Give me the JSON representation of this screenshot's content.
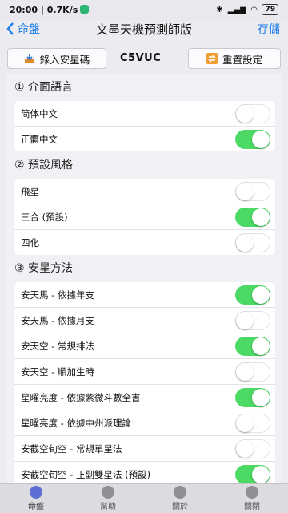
{
  "statusbar": {
    "time_speed": "20:00 | 0.7K/s",
    "battery": "79"
  },
  "nav": {
    "back_label": "命盤",
    "title": "文墨天機預測師版",
    "right_label": "存儲"
  },
  "actions": {
    "import_label": "錄入安星碼",
    "code": "C5VUC",
    "reset_label": "重置設定"
  },
  "sections": [
    {
      "title": "① 介面語言",
      "items": [
        {
          "label": "简体中文",
          "on": false
        },
        {
          "label": "正體中文",
          "on": true
        }
      ]
    },
    {
      "title": "② 預設風格",
      "items": [
        {
          "label": "飛星",
          "on": false
        },
        {
          "label": "三合 (預設)",
          "on": true
        },
        {
          "label": "四化",
          "on": false
        }
      ]
    },
    {
      "title": "③ 安星方法",
      "items": [
        {
          "label": "安天馬 - 依據年支",
          "on": true
        },
        {
          "label": "安天馬 - 依據月支",
          "on": false
        },
        {
          "label": "安天空 - 常規排法",
          "on": true
        },
        {
          "label": "安天空 - 順加生時",
          "on": false
        },
        {
          "label": "星曜亮度 - 依據紫微斗數全書",
          "on": true
        },
        {
          "label": "星曜亮度 - 依據中州派理論",
          "on": false
        },
        {
          "label": "安截空旬空 - 常規單星法",
          "on": false
        },
        {
          "label": "安截空旬空 - 正副雙星法 (預設)",
          "on": true
        }
      ]
    }
  ],
  "tabs": [
    {
      "label": "命盤",
      "icon": "eye-icon",
      "active": true
    },
    {
      "label": "幫助",
      "icon": "help-icon",
      "active": false
    },
    {
      "label": "關於",
      "icon": "info-icon",
      "active": false
    },
    {
      "label": "關閉",
      "icon": "close-icon",
      "active": false
    }
  ],
  "colors": {
    "accent": "#1a7bea",
    "toggle_on": "#4cd964"
  }
}
